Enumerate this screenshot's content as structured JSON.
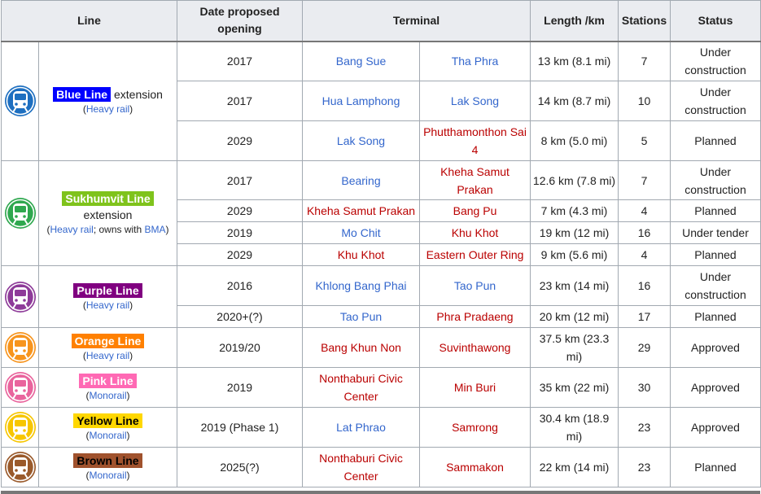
{
  "headers": {
    "line": "Line",
    "date": "Date proposed opening",
    "terminal": "Terminal",
    "length": "Length /km",
    "stations": "Stations",
    "status": "Status"
  },
  "lines": {
    "blue": {
      "name": "Blue Line",
      "suffix": " extension",
      "rail_type": "Heavy rail",
      "badge_bg": "#0000ff",
      "badge_fg": "#ffffff",
      "icon_color": "#1e6fc0",
      "icon_name": "metro-train-icon",
      "rows": [
        {
          "date": "2017",
          "terminal_a": "Bang Sue",
          "terminal_b": "Tha Phra",
          "length": "13 km (8.1 mi)",
          "stations": "7",
          "status": "Under construction"
        },
        {
          "date": "2017",
          "terminal_a": "Hua Lamphong",
          "terminal_b": "Lak Song",
          "length": "14 km (8.7 mi)",
          "stations": "10",
          "status": "Under construction"
        },
        {
          "date": "2029",
          "terminal_a": "Lak Song",
          "terminal_b": "Phutthamonthon Sai 4",
          "length": "8 km (5.0 mi)",
          "stations": "5",
          "status": "Planned"
        }
      ]
    },
    "sukhumvit": {
      "name": "Sukhumvit Line",
      "suffix": "extension",
      "rail_type": "Heavy rail",
      "owner_prefix": "; owns with ",
      "owner": "BMA",
      "badge_bg": "#7fc31c",
      "badge_fg": "#ffffff",
      "icon_color": "#2fa84f",
      "icon_name": "metro-train-icon",
      "rows": [
        {
          "date": "2017",
          "terminal_a": "Bearing",
          "terminal_b": "Kheha Samut Prakan",
          "length": "12.6 km (7.8 mi)",
          "stations": "7",
          "status": "Under construction"
        },
        {
          "date": "2029",
          "terminal_a": "Kheha Samut Prakan",
          "terminal_b": "Bang Pu",
          "length": "7 km (4.3 mi)",
          "stations": "4",
          "status": "Planned"
        },
        {
          "date": "2019",
          "terminal_a": "Mo Chit",
          "terminal_b": "Khu Khot",
          "length": "19 km (12 mi)",
          "stations": "16",
          "status": "Under tender"
        },
        {
          "date": "2029",
          "terminal_a": "Khu Khot",
          "terminal_b": "Eastern Outer Ring",
          "length": "9 km (5.6 mi)",
          "stations": "4",
          "status": "Planned"
        }
      ]
    },
    "purple": {
      "name": "Purple Line",
      "rail_type": "Heavy rail",
      "badge_bg": "#800080",
      "badge_fg": "#ffffff",
      "icon_color": "#8e3b99",
      "icon_name": "metro-train-icon",
      "rows": [
        {
          "date": "2016",
          "terminal_a": "Khlong Bang Phai",
          "terminal_b": "Tao Pun",
          "length": "23 km (14 mi)",
          "stations": "16",
          "status": "Under construction"
        },
        {
          "date": "2020+(?)",
          "terminal_a": "Tao Pun",
          "terminal_b": "Phra Pradaeng",
          "length": "20 km (12 mi)",
          "stations": "17",
          "status": "Planned"
        }
      ]
    },
    "orange": {
      "name": "Orange Line",
      "rail_type": "Heavy rail",
      "badge_bg": "#ff8000",
      "badge_fg": "#ffffff",
      "icon_color": "#f7941d",
      "icon_name": "metro-train-icon",
      "rows": [
        {
          "date": "2019/20",
          "terminal_a": "Bang Khun Non",
          "terminal_b": "Suvinthawong",
          "length": "37.5 km (23.3 mi)",
          "stations": "29",
          "status": "Approved"
        }
      ]
    },
    "pink": {
      "name": "Pink Line",
      "rail_type": "Monorail",
      "badge_bg": "#ff69b4",
      "badge_fg": "#ffffff",
      "icon_color": "#e9649d",
      "icon_name": "metro-train-icon",
      "rows": [
        {
          "date": "2019",
          "terminal_a": "Nonthaburi Civic Center",
          "terminal_b": "Min Buri",
          "length": "35 km (22 mi)",
          "stations": "30",
          "status": "Approved"
        }
      ]
    },
    "yellow": {
      "name": "Yellow Line",
      "rail_type": "Monorail",
      "badge_bg": "#ffd700",
      "badge_fg": "#000000",
      "icon_color": "#f7c600",
      "icon_name": "metro-train-icon",
      "rows": [
        {
          "date": "2019 (Phase 1)",
          "terminal_a": "Lat Phrao",
          "terminal_b": "Samrong",
          "length": "30.4 km (18.9 mi)",
          "stations": "23",
          "status": "Approved"
        }
      ]
    },
    "brown": {
      "name": "Brown Line",
      "rail_type": "Monorail",
      "badge_bg": "#a0522d",
      "badge_fg": "#000000",
      "icon_color": "#9a5a2b",
      "icon_name": "metro-train-icon",
      "rows": [
        {
          "date": "2025(?)",
          "terminal_a": "Nonthaburi Civic Center",
          "terminal_b": "Sammakon",
          "length": "22 km (14 mi)",
          "stations": "23",
          "status": "Planned"
        }
      ]
    }
  },
  "symbols": {
    "open_paren": "(",
    "close_paren": ")"
  }
}
